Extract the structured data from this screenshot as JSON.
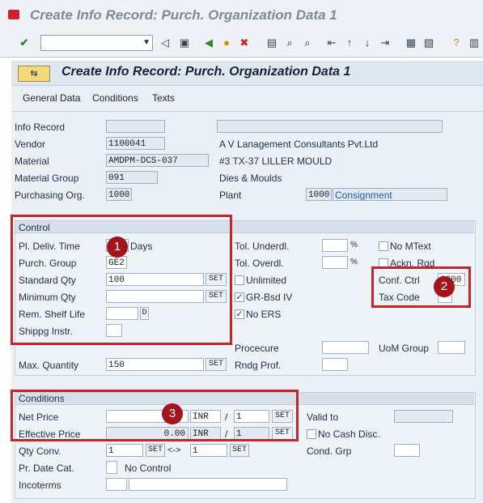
{
  "window": {
    "title": "Create Info Record: Purch. Organization Data 1"
  },
  "screen": {
    "header": "Create Info Record: Purch. Organization Data 1"
  },
  "menu": [
    "General Data",
    "Conditions",
    "Texts"
  ],
  "general": {
    "info_record_label": "Info Record",
    "vendor_label": "Vendor",
    "vendor_value": "1100041",
    "vendor_name": "A V Lanagement Consultants Pvt.Ltd",
    "material_label": "Material",
    "material_value": "AMDPM-DCS-037",
    "material_name": "#3 TX-37 LILLER MOULD",
    "matgroup_label": "Material Group",
    "matgroup_value": "091",
    "matgroup_name": "Dies & Moulds",
    "porg_label": "Purchasing Org.",
    "porg_value": "1000",
    "plant_label": "Plant",
    "plant_value": "1000",
    "plant_name": "Consignment"
  },
  "control": {
    "title": "Control",
    "pl_deliv_label": "Pl. Deliv. Time",
    "days": "Days",
    "purch_group_label": "Purch. Group",
    "purch_group_value": "GE2",
    "std_qty_label": "Standard Qty",
    "std_qty_value": "100",
    "min_qty_label": "Minimum Qty",
    "shelf_label": "Rem. Shelf Life",
    "shelf_unit": "D",
    "shipping_label": "Shippg Instr.",
    "tol_under_label": "Tol. Underdl.",
    "tol_over_label": "Tol. Overdl.",
    "pct": "%",
    "unlimited": "Unlimited",
    "grbsd": "GR-Bsd IV",
    "no_ers": "No ERS",
    "no_mtext": "No MText",
    "ackn": "Ackn. Rqd",
    "conf_label": "Conf. Ctrl",
    "conf_value": "0000",
    "tax_label": "Tax Code",
    "procedure_label": "Procecure",
    "uom_label": "UoM Group",
    "max_qty_label": "Max. Quantity",
    "max_qty_value": "150",
    "rndg_label": "Rndg Prof.",
    "set": "SET"
  },
  "conditions": {
    "title": "Conditions",
    "net_price_label": "Net Price",
    "currency": "INR",
    "slash": "/",
    "per": "1",
    "valid_to_label": "Valid to",
    "eff_price_label": "Effective Price",
    "eff_price_value": "0.00",
    "no_cash": "No Cash Disc.",
    "qty_conv_label": "Qty Conv.",
    "qc1": "1",
    "qc2": "1",
    "arrow": "<->",
    "cond_grp_label": "Cond. Grp",
    "pr_date_label": "Pr. Date Cat.",
    "no_control": "No Control",
    "incoterms_label": "Incoterms"
  },
  "badges": [
    "1",
    "2",
    "3"
  ]
}
